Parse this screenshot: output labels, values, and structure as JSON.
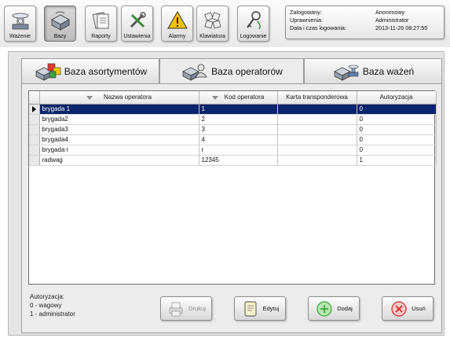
{
  "toolbar": {
    "buttons": [
      {
        "label": "Ważenie",
        "icon": "scale-icon"
      },
      {
        "label": "Bazy",
        "icon": "database-icon",
        "active": true
      },
      {
        "label": "Raporty",
        "icon": "reports-icon"
      },
      {
        "label": "Ustawienia",
        "icon": "tools-icon"
      },
      {
        "label": "Alarmy",
        "icon": "warning-icon"
      },
      {
        "label": "Klawiatura",
        "icon": "keyboard-icon"
      },
      {
        "label": "Logowanie",
        "icon": "login-icon"
      }
    ]
  },
  "login": {
    "logged_label": "Zalogowany:",
    "logged_value": "Anonimowy",
    "rights_label": "Uprawnienia:",
    "rights_value": "Administrator",
    "datetime_label": "Data i czas logowania:",
    "datetime_value": "2013-11-26 08:27:55"
  },
  "tabs": [
    {
      "label": "Baza asortymentów",
      "icon": "products-icon"
    },
    {
      "label": "Baza operatorów",
      "icon": "operators-icon",
      "active": true
    },
    {
      "label": "Baza ważeń",
      "icon": "weighings-icon"
    }
  ],
  "table": {
    "columns": [
      "Nazwa operatora",
      "Kod operatora",
      "Karta transponderowa",
      "Autoryzacja"
    ],
    "rows": [
      {
        "name": "brygada 1",
        "code": "1",
        "card": "",
        "auth": "0",
        "selected": true
      },
      {
        "name": "brygada2",
        "code": "2",
        "card": "",
        "auth": "0"
      },
      {
        "name": "brygada3",
        "code": "3",
        "card": "",
        "auth": "0"
      },
      {
        "name": "brygada4",
        "code": "4",
        "card": "",
        "auth": "0"
      },
      {
        "name": "brygada r",
        "code": "r",
        "card": "",
        "auth": "0"
      },
      {
        "name": "radwag",
        "code": "12345",
        "card": "",
        "auth": "1"
      }
    ]
  },
  "legend": {
    "title": "Autoryzacja:",
    "line1": "0 - wagowy",
    "line2": "1 - administrator"
  },
  "actions": {
    "print": "Drukuj",
    "edit": "Edytuj",
    "add": "Dodaj",
    "delete": "Usuń"
  },
  "colors": {
    "selection": "#0a246a",
    "add_icon": "#3aa63a",
    "delete_icon": "#d42a2a",
    "warning_icon": "#f2c200"
  }
}
